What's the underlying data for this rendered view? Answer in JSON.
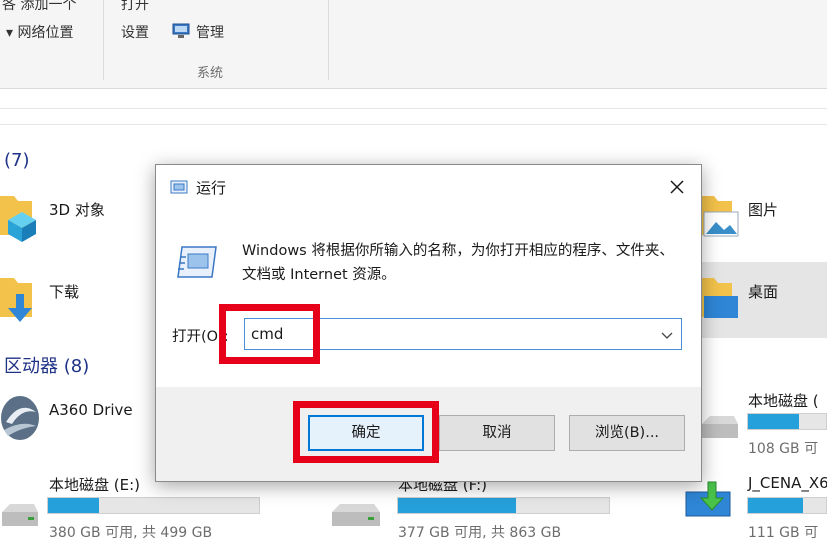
{
  "ribbon": {
    "cut_left": "各 添加一个",
    "net_location": "▾ 网络位置",
    "cut_open": "打开",
    "settings": "设置",
    "manage": "管理",
    "group_system": "系统"
  },
  "explorer": {
    "sec_folders": "(7)",
    "sec_drives": "区动器 (8)",
    "folders": [
      {
        "label": "3D 对象"
      },
      {
        "label": "下载"
      },
      {
        "label": "图片"
      },
      {
        "label": "桌面"
      }
    ],
    "drives": [
      {
        "label": "A360 Drive",
        "info": ""
      },
      {
        "label": "本地磁盘 (E:)",
        "info": "380 GB 可用, 共 499 GB",
        "used": 0.24
      },
      {
        "label": "本地磁盘 (F:)",
        "info": "377 GB 可用, 共 863 GB",
        "used": 0.56
      },
      {
        "label": "本地磁盘 (",
        "info": "108 GB 可",
        "used": 0.65
      },
      {
        "label": "J_CENA_X6",
        "info": "111 GB 可",
        "used": 0.7
      }
    ]
  },
  "dialog": {
    "title": "运行",
    "description": "Windows 将根据你所输入的名称，为你打开相应的程序、文件夹、文档或 Internet 资源。",
    "open_label": "打开(O):",
    "input_value": "cmd",
    "ok": "确定",
    "cancel": "取消",
    "browse": "浏览(B)..."
  },
  "colors": {
    "accent": "#0078d7",
    "highlight_red": "#e6001a",
    "drive_fill": "#26a0da"
  }
}
